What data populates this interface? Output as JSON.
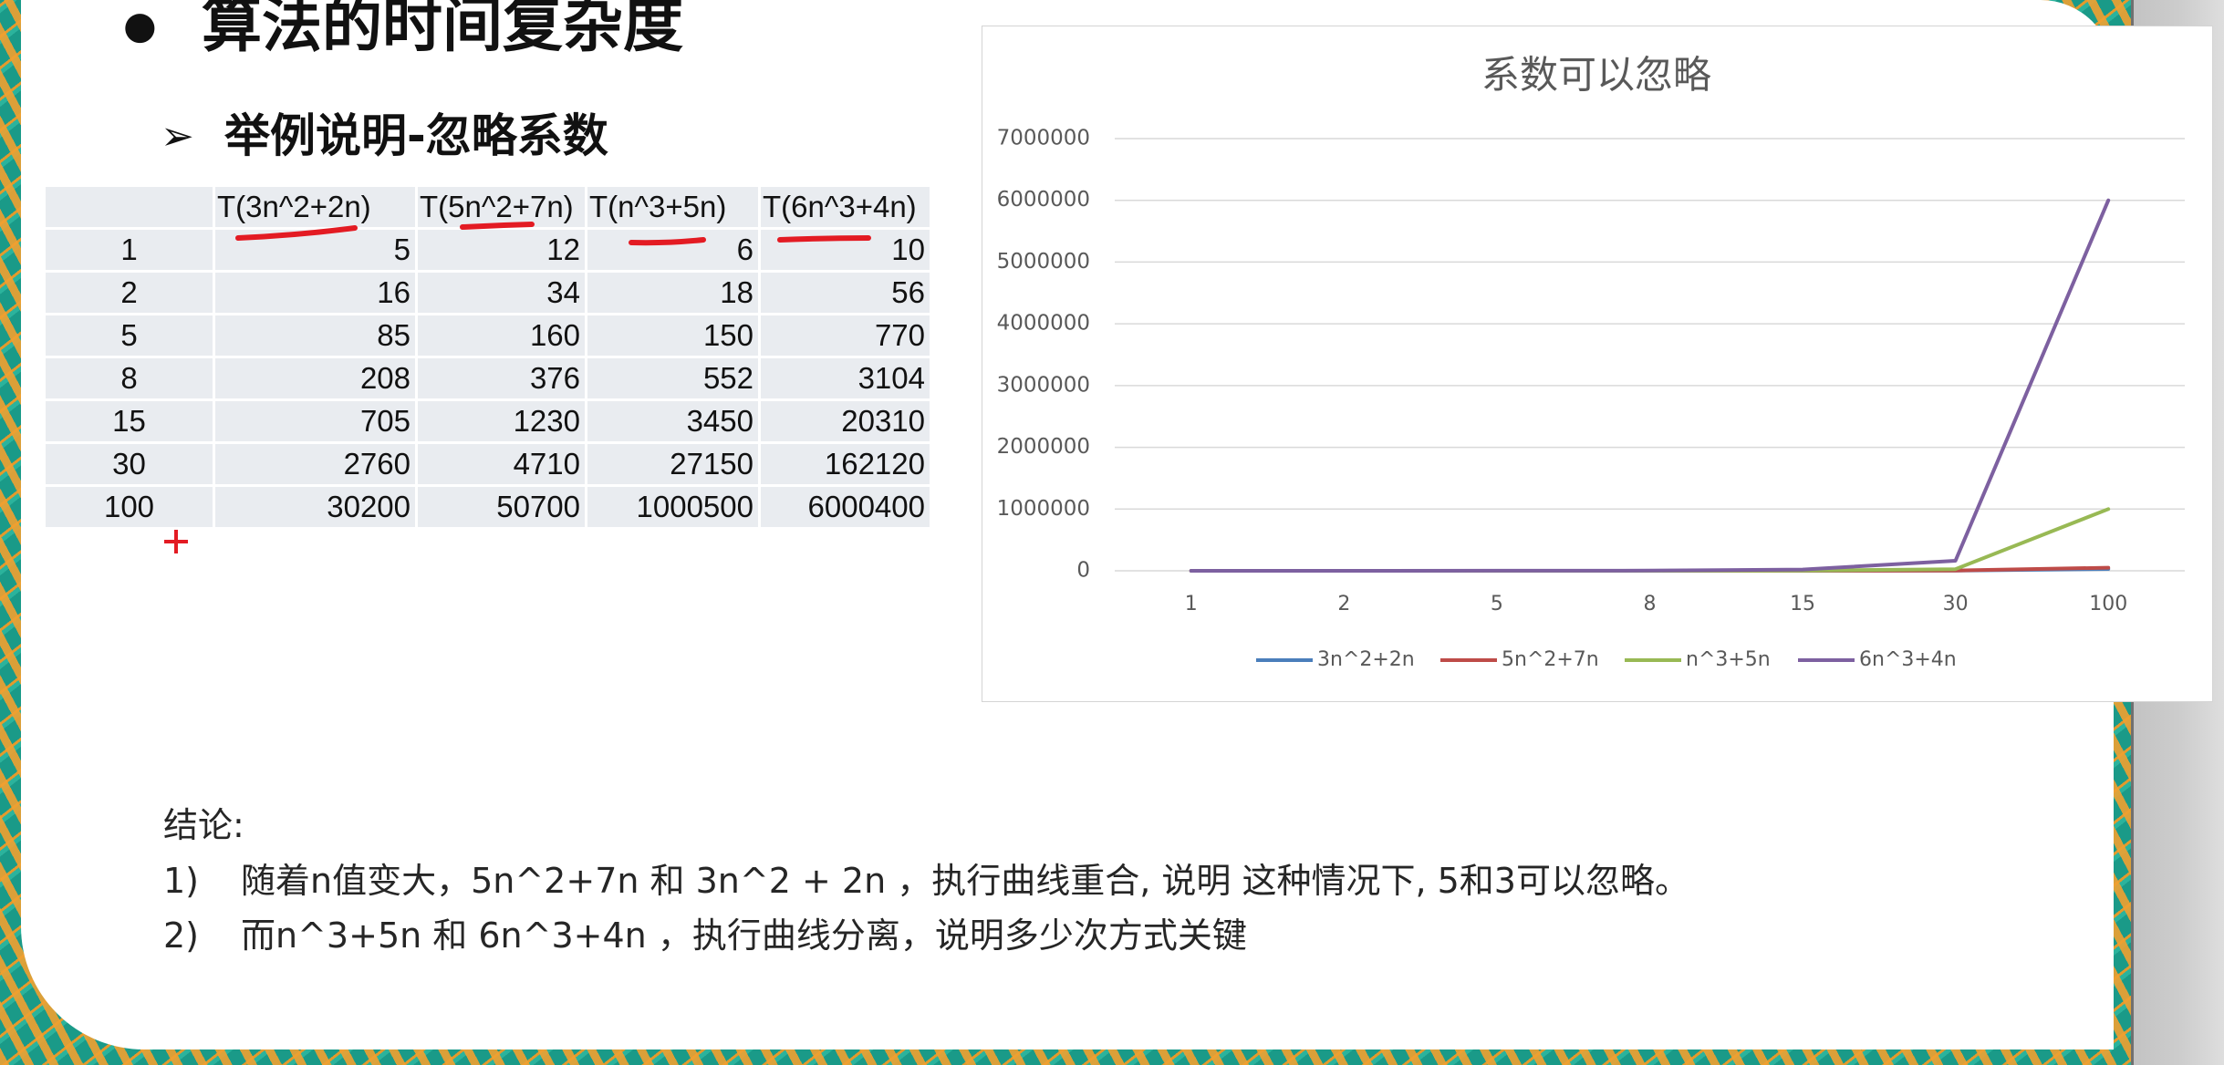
{
  "slide": {
    "bullet": "●",
    "title": "算法的时间复杂度",
    "subtitle_marker": "➢",
    "subtitle": "举例说明-忽略系数"
  },
  "table": {
    "headers": [
      "",
      "T(3n^2+2n)",
      "T(5n^2+7n)",
      "T(n^3+5n)",
      "T(6n^3+4n)"
    ],
    "rows": [
      [
        "1",
        "5",
        "12",
        "6",
        "10"
      ],
      [
        "2",
        "16",
        "34",
        "18",
        "56"
      ],
      [
        "5",
        "85",
        "160",
        "150",
        "770"
      ],
      [
        "8",
        "208",
        "376",
        "552",
        "3104"
      ],
      [
        "15",
        "705",
        "1230",
        "3450",
        "20310"
      ],
      [
        "30",
        "2760",
        "4710",
        "27150",
        "162120"
      ],
      [
        "100",
        "30200",
        "50700",
        "1000500",
        "6000400"
      ]
    ]
  },
  "chart_data": {
    "type": "line",
    "title": "系数可以忽略",
    "xlabel": "",
    "ylabel": "",
    "categories": [
      "1",
      "2",
      "5",
      "8",
      "15",
      "30",
      "100"
    ],
    "ylim": [
      0,
      7000000
    ],
    "yticks": [
      "0",
      "1000000",
      "2000000",
      "3000000",
      "4000000",
      "5000000",
      "6000000",
      "7000000"
    ],
    "grid": true,
    "legend": "bottom",
    "series": [
      {
        "name": "3n^2+2n",
        "color": "#4a7ebb",
        "values": [
          5,
          16,
          85,
          208,
          705,
          2760,
          30200
        ]
      },
      {
        "name": "5n^2+7n",
        "color": "#be4b48",
        "values": [
          12,
          34,
          160,
          376,
          1230,
          4710,
          50700
        ]
      },
      {
        "name": "n^3+5n",
        "color": "#98b954",
        "values": [
          6,
          18,
          150,
          552,
          3450,
          27150,
          1000500
        ]
      },
      {
        "name": "6n^3+4n",
        "color": "#7d60a0",
        "values": [
          10,
          56,
          770,
          3104,
          20310,
          162120,
          6000400
        ]
      }
    ]
  },
  "conclusion": {
    "heading": "结论:",
    "items": [
      {
        "num": "1)",
        "text": "随着n值变大，5n^2+7n 和 3n^2 + 2n ，执行曲线重合, 说明  这种情况下, 5和3可以忽略。"
      },
      {
        "num": "2)",
        "text": "而n^3+5n 和 6n^3+4n  ，执行曲线分离，说明多少次方式关键"
      }
    ]
  },
  "colors": {
    "annotation_red": "#e31b23",
    "table_cell_bg": "#e9ecf0",
    "chart_text": "#595959",
    "gridline": "#d9d9d9"
  }
}
